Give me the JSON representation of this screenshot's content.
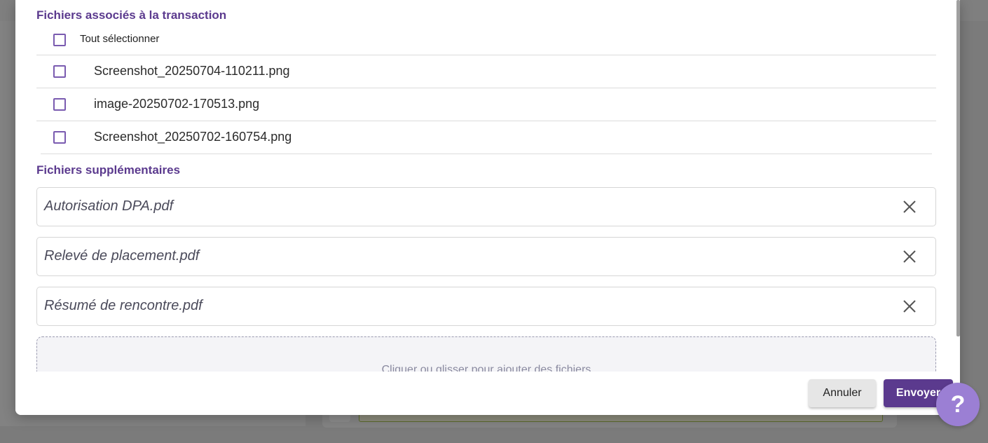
{
  "linked_files": {
    "title": "Fichiers associés à la transaction",
    "select_all_label": "Tout sélectionner",
    "items": [
      {
        "name": "Screenshot_20250704-110211.png"
      },
      {
        "name": "image-20250702-170513.png"
      },
      {
        "name": "Screenshot_20250702-160754.png"
      }
    ]
  },
  "extra_files": {
    "title": "Fichiers supplémentaires",
    "items": [
      {
        "name": "Autorisation DPA.pdf"
      },
      {
        "name": "Relevé de placement.pdf"
      },
      {
        "name": "Résumé de rencontre.pdf"
      }
    ],
    "dropzone_text": "Cliquer ou glisser pour ajouter des fichiers"
  },
  "footer": {
    "cancel_label": "Annuler",
    "send_label": "Envoyer"
  },
  "help": {
    "label": "?"
  },
  "colors": {
    "accent": "#5b3a8e",
    "help_button": "#9b7fd4",
    "checkbox_border": "#7a5bb0"
  }
}
